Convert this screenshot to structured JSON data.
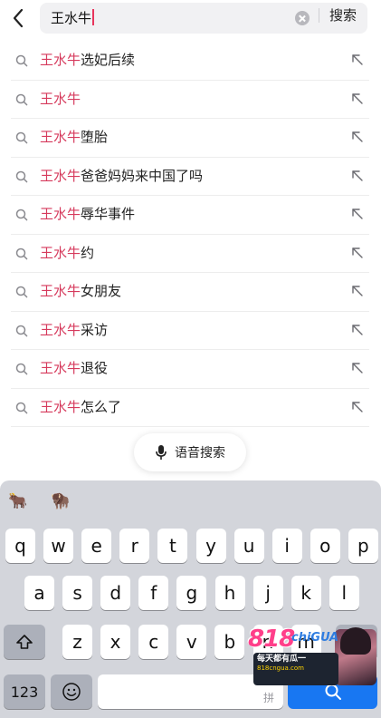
{
  "search": {
    "query": "王水牛",
    "button_label": "搜索"
  },
  "suggestions": [
    {
      "keyword": "王水牛",
      "rest": "选妃后续"
    },
    {
      "keyword": "王水牛",
      "rest": ""
    },
    {
      "keyword": "王水牛",
      "rest": "堕胎"
    },
    {
      "keyword": "王水牛",
      "rest": "爸爸妈妈来中国了吗"
    },
    {
      "keyword": "王水牛",
      "rest": "辱华事件"
    },
    {
      "keyword": "王水牛",
      "rest": "约"
    },
    {
      "keyword": "王水牛",
      "rest": "女朋友"
    },
    {
      "keyword": "王水牛",
      "rest": "采访"
    },
    {
      "keyword": "王水牛",
      "rest": "退役"
    },
    {
      "keyword": "王水牛",
      "rest": "怎么了"
    }
  ],
  "voice_search": {
    "label": "语音搜索"
  },
  "keyboard": {
    "emoji_candidates": [
      "🐂",
      "🦬"
    ],
    "row1": [
      "q",
      "w",
      "e",
      "r",
      "t",
      "y",
      "u",
      "i",
      "o",
      "p"
    ],
    "row2": [
      "a",
      "s",
      "d",
      "f",
      "g",
      "h",
      "j",
      "k",
      "l"
    ],
    "row3": [
      "z",
      "x",
      "c",
      "v",
      "b",
      "n",
      "m"
    ],
    "numbers_key": "123",
    "space_hint": "拼"
  },
  "ad": {
    "logo": "818",
    "brand": "chiGUA",
    "line1": "每天都有瓜一",
    "line2": "818cngua.com"
  },
  "colors": {
    "keyword_highlight": "#d63a5c",
    "keyboard_bg": "#d3d5db",
    "search_key_blue": "#1877f2"
  }
}
